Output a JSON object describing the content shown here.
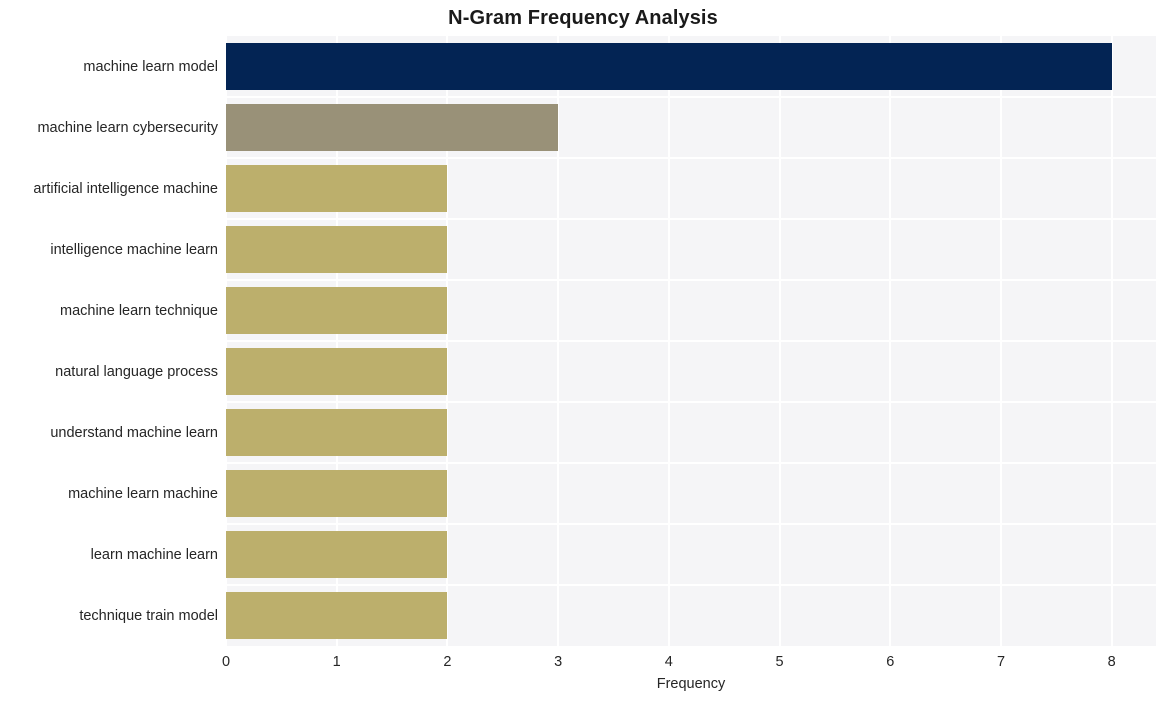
{
  "chart_data": {
    "type": "bar",
    "orientation": "horizontal",
    "title": "N-Gram Frequency Analysis",
    "xlabel": "Frequency",
    "ylabel": "",
    "xlim": [
      0,
      8.4
    ],
    "ylim": [
      0,
      10
    ],
    "grid": true,
    "legend": null,
    "xticks": [
      "0",
      "1",
      "2",
      "3",
      "4",
      "5",
      "6",
      "7",
      "8"
    ],
    "xtick_values": [
      0,
      1,
      2,
      3,
      4,
      5,
      6,
      7,
      8
    ],
    "categories": [
      "machine learn model",
      "machine learn cybersecurity",
      "artificial intelligence machine",
      "intelligence machine learn",
      "machine learn technique",
      "natural language process",
      "understand machine learn",
      "machine learn machine",
      "learn machine learn",
      "technique train model"
    ],
    "values": [
      8,
      3,
      2,
      2,
      2,
      2,
      2,
      2,
      2,
      2
    ],
    "bar_colors": [
      "#032454",
      "#999178",
      "#bcaf6c",
      "#bcaf6c",
      "#bcaf6c",
      "#bcaf6c",
      "#bcaf6c",
      "#bcaf6c",
      "#bcaf6c",
      "#bcaf6c"
    ]
  },
  "style": {
    "figure_background": "#ffffff",
    "plot_background": "#f5f5f7",
    "grid_color": "#ffffff",
    "text_color": "#262626",
    "title_color": "#1a1a1a"
  }
}
